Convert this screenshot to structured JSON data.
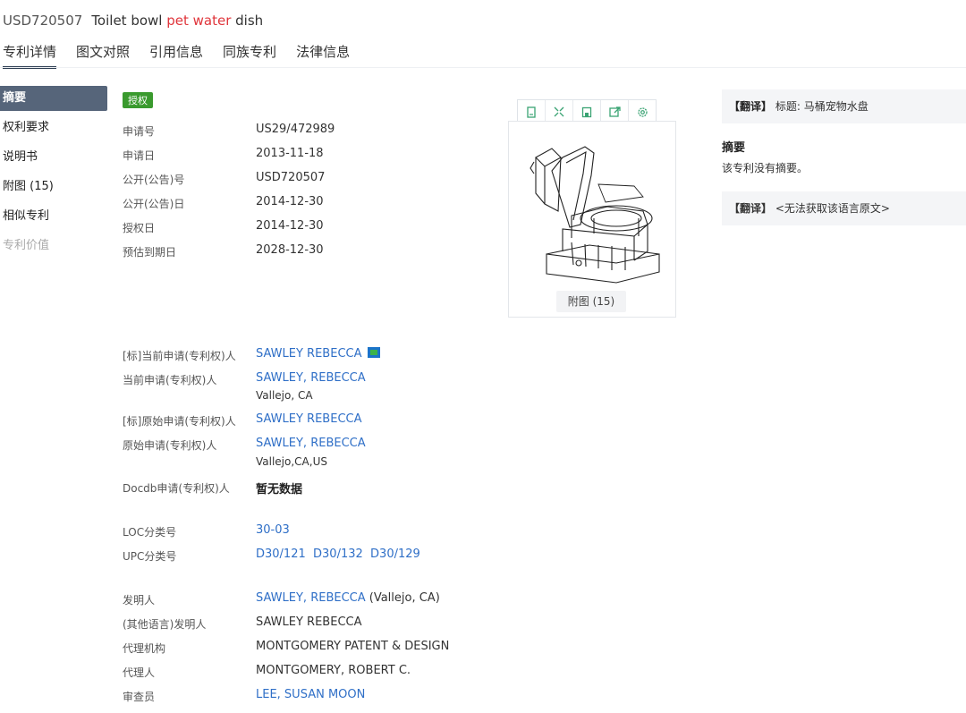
{
  "header": {
    "patent_no": "USD720507",
    "title_pre": "Toilet bowl ",
    "title_hl": "pet water",
    "title_post": " dish"
  },
  "tabs": [
    "专利详情",
    "图文对照",
    "引用信息",
    "同族专利",
    "法律信息"
  ],
  "sidebar": [
    "摘要",
    "权利要求",
    "说明书",
    "附图 (15)",
    "相似专利",
    "专利价值"
  ],
  "status_badge": "授权",
  "basic_fields": [
    {
      "label": "申请号",
      "value": "US29/472989"
    },
    {
      "label": "申请日",
      "value": "2013-11-18"
    },
    {
      "label": "公开(公告)号",
      "value": "USD720507"
    },
    {
      "label": "公开(公告)日",
      "value": "2014-12-30"
    },
    {
      "label": "授权日",
      "value": "2014-12-30"
    },
    {
      "label": "预估到期日",
      "value": "2028-12-30"
    }
  ],
  "people": {
    "cur_std_label": "[标]当前申请(专利权)人",
    "cur_std_value": "SAWLEY REBECCA",
    "cur_label": "当前申请(专利权)人",
    "cur_value": "SAWLEY, REBECCA",
    "cur_loc": "Vallejo, CA",
    "orig_std_label": "[标]原始申请(专利权)人",
    "orig_std_value": "SAWLEY REBECCA",
    "orig_label": "原始申请(专利权)人",
    "orig_value": "SAWLEY, REBECCA",
    "orig_loc": "Vallejo,CA,US",
    "docdb_label": "Docdb申请(专利权)人",
    "docdb_value": "暂无数据"
  },
  "classes": {
    "loc_label": "LOC分类号",
    "loc_value": "30-03",
    "upc_label": "UPC分类号",
    "upc_values": [
      "D30/121",
      "D30/132",
      "D30/129"
    ]
  },
  "inventors": {
    "inv_label": "发明人",
    "inv_value": "SAWLEY, REBECCA",
    "inv_loc": " (Vallejo, CA)",
    "other_label": "(其他语言)发明人",
    "other_value": "SAWLEY REBECCA",
    "agency_label": "代理机构",
    "agency_value": "MONTGOMERY PATENT & DESIGN",
    "agent_label": "代理人",
    "agent_value": "MONTGOMERY, ROBERT C.",
    "examiner_label": "审查员",
    "examiner_value": "LEE, SUSAN MOON"
  },
  "figure": {
    "label": "附图 (15)"
  },
  "toolbar_icons": [
    "doc-icon",
    "expand-icon",
    "save-icon",
    "share-icon",
    "settings-icon"
  ],
  "right": {
    "trans1_tag": "【翻译】",
    "trans1_text": "标题: 马桶宠物水盘",
    "abstract_title": "摘要",
    "abstract_text": "该专利没有摘要。",
    "trans2_tag": "【翻译】",
    "trans2_text": "<无法获取该语言原文>"
  },
  "colors": {
    "badge": "#3a9a2e",
    "link": "#2f6fc7",
    "sidebar_active": "#56657a",
    "highlight": "#e0353b"
  }
}
